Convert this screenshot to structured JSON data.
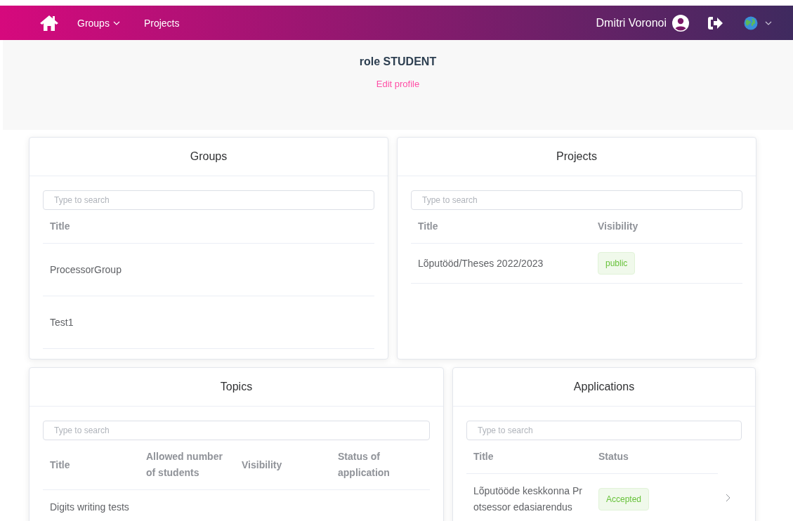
{
  "nav": {
    "menu": [
      {
        "label": "Groups",
        "dropdown": true
      },
      {
        "label": "Projects",
        "dropdown": false
      }
    ],
    "user": "Dmitri Voronoi"
  },
  "profile": {
    "role": "role STUDENT",
    "link": "Edit profile"
  },
  "groups": {
    "title": "Groups",
    "placeholder": "Type to search",
    "columns": [
      "Title"
    ],
    "rows": [
      {
        "title": "ProcessorGroup"
      },
      {
        "title": "Test1"
      }
    ]
  },
  "projects": {
    "title": "Projects",
    "placeholder": "Type to search",
    "columns": [
      "Title",
      "Visibility"
    ],
    "rows": [
      {
        "title": "Lõputööd/Theses 2022/2023",
        "visibility": "public",
        "kind": "success"
      }
    ]
  },
  "topics": {
    "title": "Topics",
    "placeholder": "Type to search",
    "columns": [
      "Title",
      "Allowed number of students",
      "Visibility",
      "Status of application"
    ],
    "rows": [
      {
        "title": "Digits writing tests"
      }
    ]
  },
  "applications": {
    "title": "Applications",
    "placeholder": "Type to search",
    "columns": [
      "Title",
      "Status"
    ],
    "rows": [
      {
        "title": "Lõputööde keskkonna Pr otsessor edasiarendus",
        "status": "Accepted",
        "kind": "success"
      }
    ]
  }
}
